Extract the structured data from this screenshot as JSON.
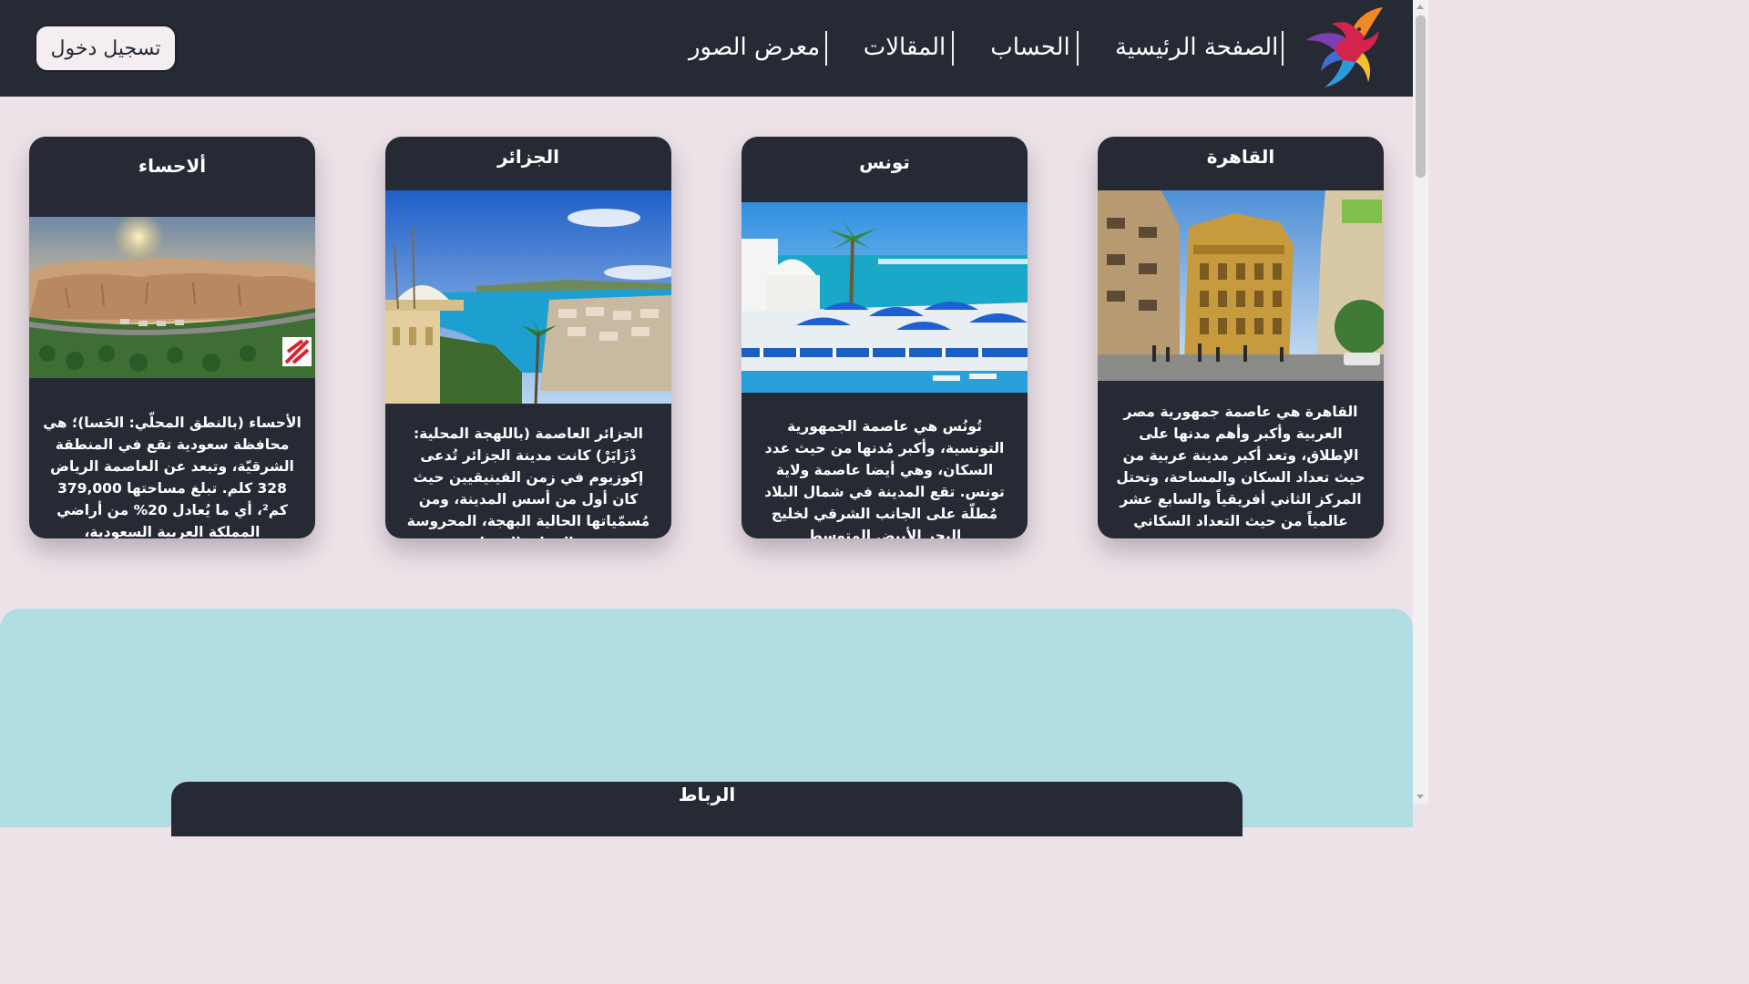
{
  "header": {
    "logo_icon": "phoenix-bird-logo-icon",
    "nav": [
      {
        "label": "الصفحة الرئيسية"
      },
      {
        "label": "الحساب"
      },
      {
        "label": "المقالات"
      },
      {
        "label": "معرض الصور"
      }
    ],
    "login_label": "تسجيل دخول"
  },
  "cards": [
    {
      "title": "القاهرة",
      "image_icon": "cairo-street-photo",
      "text": "القاهرة هي عاصمة جمهورية مصر العربية وأكبر وأهم مدنها على الإطلاق، وتعد أكبر مدينة عربية من حيث تعداد السكان والمساحة، وتحتل المركز الثاني أفريقياً والسابع عشر عالمياً من حيث التعداد السكاني"
    },
    {
      "title": "تونس",
      "image_icon": "tunis-sidi-bou-said-photo",
      "text": "تُونُس هي عاصمة الجمهورية التونسية، وأكبر مُدنها من حيث عدد السكان، وهي أيضا عاصمة ولاية تونس. تقع المدينة في شمال البلاد مُطلّة على الجانب الشرقي لخليج البحر الأبيض المتوسط"
    },
    {
      "title": "الجزائر",
      "image_icon": "algiers-bay-photo",
      "text": "الجزائر العاصمة (باللهجة المحلية: دْزَايَرْ) كانت مدينة الجزائر تُدعى إكوزيوم في زمن الفينيقيين حيث كان أول من أسس المدينة، ومن مُسمّياتها الحالية البهجة، المحروسة والجزائر البيضا."
    },
    {
      "title": "ألاحساء",
      "image_icon": "al-ahsa-mountain-photo",
      "text": "الأحساء (بالنطق المحلّي: الحَسا)؛ هي محافظة سعودية تقع في المنطقة الشرقيّة، وتبعد عن العاصمة الرياض 328 كلم. تبلغ مساحتها 379,000 كم²، أي ما يُعادل 20% من أراضي المملكة العربية السعودية،"
    }
  ],
  "footer_card": {
    "title": "الرباط"
  },
  "colors": {
    "dark": "#262a35",
    "page_bg": "#ede2e8",
    "footer_bg": "#b1dde3"
  }
}
